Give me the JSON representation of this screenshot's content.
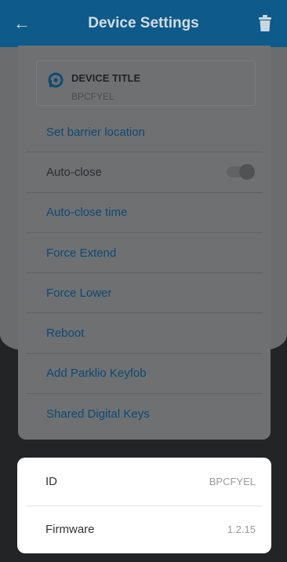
{
  "appbar": {
    "title": "Device Settings",
    "back_icon": "arrow-left-icon",
    "trash_icon": "trash-icon"
  },
  "device": {
    "label": "DEVICE TITLE",
    "name": "BPCFYEL"
  },
  "menu": {
    "items": [
      {
        "label": "Set barrier location",
        "type": "link"
      },
      {
        "label": "Auto-close",
        "type": "toggle",
        "toggle_on": false
      },
      {
        "label": "Auto-close time",
        "type": "link"
      },
      {
        "label": "Force Extend",
        "type": "link"
      },
      {
        "label": "Force Lower",
        "type": "link"
      },
      {
        "label": "Reboot",
        "type": "link"
      },
      {
        "label": "Add Parklio Keyfob",
        "type": "link"
      },
      {
        "label": "Shared Digital Keys",
        "type": "link"
      }
    ]
  },
  "sheet": {
    "rows": [
      {
        "key": "ID",
        "value": "BPCFYEL"
      },
      {
        "key": "Firmware",
        "value": "1.2.15"
      }
    ]
  },
  "colors": {
    "appbar": "#0e5a8a",
    "link": "#0e4a74",
    "dim_overlay": "#222426"
  }
}
